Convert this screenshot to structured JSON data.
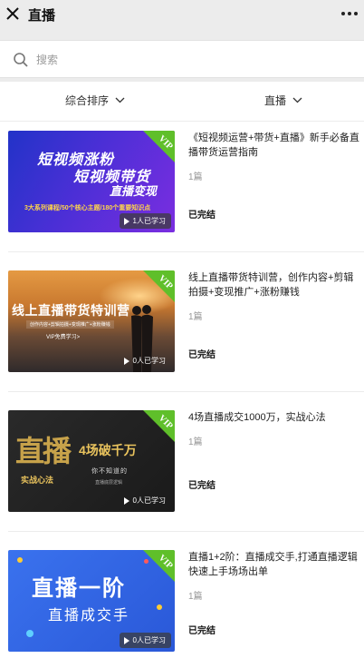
{
  "header": {
    "title": "直播"
  },
  "search": {
    "placeholder": "搜索"
  },
  "filters": [
    {
      "label": "综合排序"
    },
    {
      "label": "直播"
    }
  ],
  "colors": {
    "topbar_bg": "#ececec",
    "vip_green": "#5fbf2a",
    "status_text": "#111111",
    "muted_text": "#999999"
  },
  "courses": [
    {
      "title": "《短视频运营+带货+直播》新手必备直播带货运营指南",
      "count": "1篇",
      "status": "已完结",
      "learners": "1人已学习",
      "thumb": {
        "lines": [
          "短视频涨粉",
          "短视频带货",
          "直播变现",
          "3大系列课程/50个核心主题/180个重要知识点"
        ]
      }
    },
    {
      "title": "线上直播带货特训营，创作内容+剪辑拍摄+变现推广+涨粉赚钱",
      "count": "1篇",
      "status": "已完结",
      "learners": "0人已学习",
      "thumb": {
        "lines": [
          "线上直播带货特训营",
          "创作内容+剪辑拍摄+变现推广+涨粉赚钱",
          "VIP免费学习>"
        ]
      }
    },
    {
      "title": "4场直播成交1000万，实战心法",
      "count": "1篇",
      "status": "已完结",
      "learners": "0人已学习",
      "thumb": {
        "lines": [
          "直播",
          "4场破千万",
          "实战心法",
          "你不知道的",
          "直播底层逻辑"
        ]
      }
    },
    {
      "title": "直播1+2阶：直播成交手,打通直播逻辑快速上手场场出单",
      "count": "1篇",
      "status": "已完结",
      "learners": "0人已学习",
      "thumb": {
        "lines": [
          "直播一阶",
          "直播成交手"
        ]
      }
    }
  ],
  "badge": {
    "label": "VIP"
  }
}
